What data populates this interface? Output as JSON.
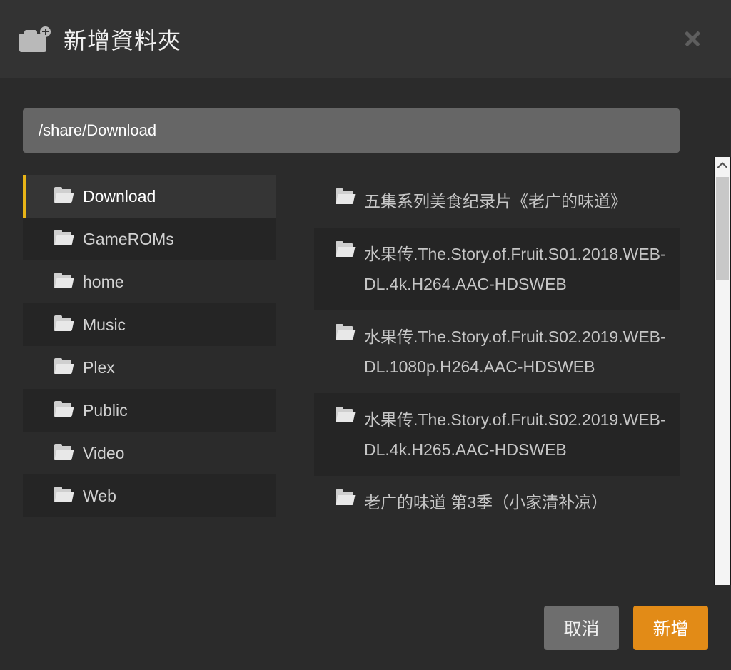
{
  "dialog": {
    "title": "新增資料夾",
    "title_icon": "folder-plus-icon",
    "close_icon": "close-icon"
  },
  "path_input": {
    "value": "/share/Download",
    "placeholder": "/share/Download"
  },
  "sidebar": {
    "items": [
      {
        "label": "Download",
        "icon": "folder-icon",
        "selected": true
      },
      {
        "label": "GameROMs",
        "icon": "folder-icon",
        "selected": false
      },
      {
        "label": "home",
        "icon": "folder-icon",
        "selected": false
      },
      {
        "label": "Music",
        "icon": "folder-icon",
        "selected": false
      },
      {
        "label": "Plex",
        "icon": "folder-icon",
        "selected": false
      },
      {
        "label": "Public",
        "icon": "folder-icon",
        "selected": false
      },
      {
        "label": "Video",
        "icon": "folder-icon",
        "selected": false
      },
      {
        "label": "Web",
        "icon": "folder-icon",
        "selected": false
      }
    ]
  },
  "filelist": {
    "items": [
      {
        "name": "五集系列美食纪录片《老广的味道》",
        "icon": "folder-icon"
      },
      {
        "name": "水果传.The.Story.of.Fruit.S01.2018.WEB-DL.4k.H264.AAC-HDSWEB",
        "icon": "folder-icon"
      },
      {
        "name": "水果传.The.Story.of.Fruit.S02.2019.WEB-DL.1080p.H264.AAC-HDSWEB",
        "icon": "folder-icon"
      },
      {
        "name": "水果传.The.Story.of.Fruit.S02.2019.WEB-DL.4k.H265.AAC-HDSWEB",
        "icon": "folder-icon"
      },
      {
        "name": "老广的味道 第3季（小家清补凉）",
        "icon": "folder-icon"
      }
    ]
  },
  "scrollbar": {
    "up_icon": "chevron-up-icon",
    "down_icon": "chevron-down-icon"
  },
  "footer": {
    "cancel_label": "取消",
    "confirm_label": "新增"
  },
  "colors": {
    "accent": "#e28b17",
    "selection_marker": "#e8b417",
    "header_bg": "#333333",
    "body_bg": "#2b2b2b",
    "row_alt_bg": "#252525",
    "row_selected_bg": "#353535",
    "input_bg": "#666666",
    "cancel_bg": "#6e6e6e"
  }
}
